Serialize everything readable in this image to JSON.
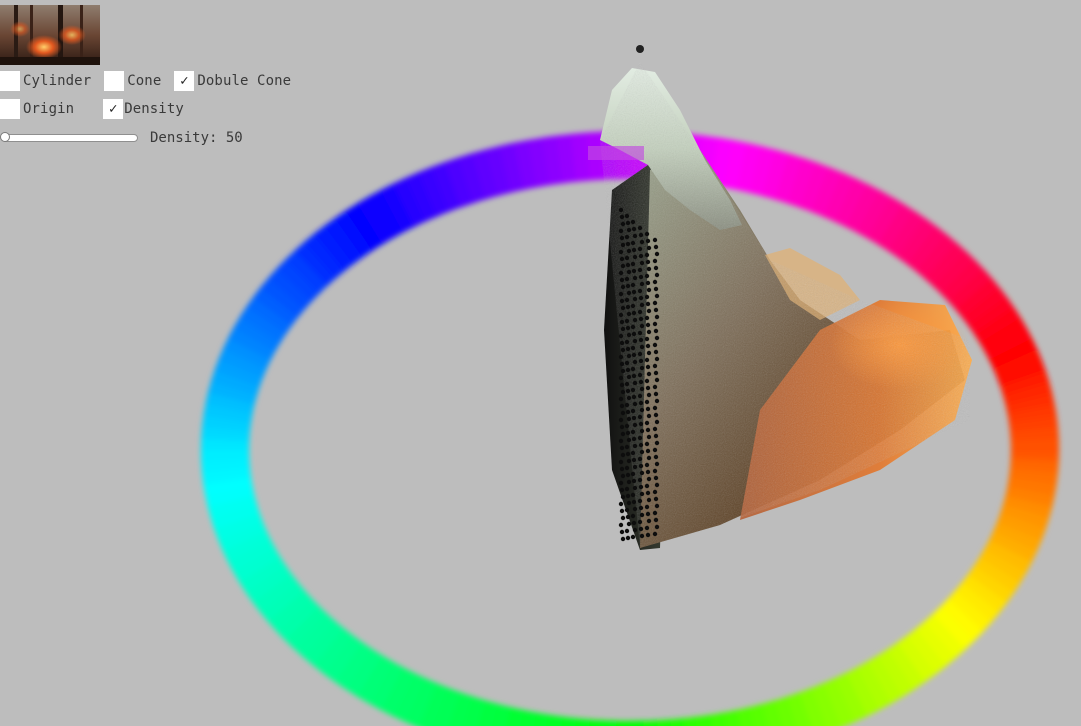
{
  "controls": {
    "checkboxes_row1": [
      {
        "label": "Cylinder",
        "checked": false
      },
      {
        "label": "Cone",
        "checked": false
      },
      {
        "label": "Dobule Cone",
        "checked": true
      }
    ],
    "checkboxes_row2": [
      {
        "label": "Origin",
        "checked": false
      },
      {
        "label": "Density",
        "checked": true
      }
    ],
    "density_label": "Density:",
    "density_value": "50",
    "density_slider": 0
  },
  "colors": {
    "background": "#bdbdbd",
    "ring_hues": [
      "#ff00ff",
      "#ff0000",
      "#ff8000",
      "#ffff00",
      "#00ff00",
      "#00ffff",
      "#0080ff",
      "#0000ff",
      "#8000ff"
    ]
  },
  "icons": {
    "check": "check-icon"
  }
}
